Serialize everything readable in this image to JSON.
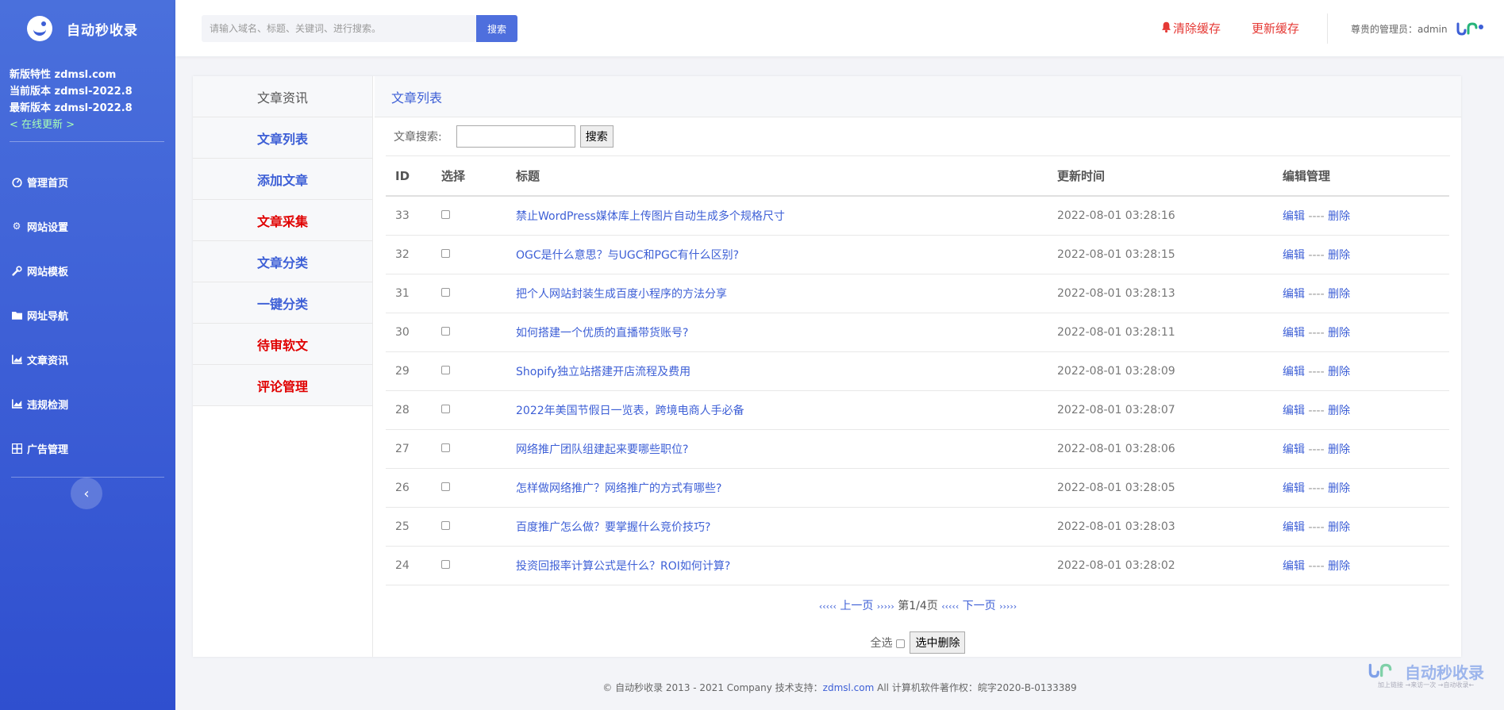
{
  "brand": {
    "name": "自动秒收录"
  },
  "version": {
    "feature": "新版特性 zdmsl.com",
    "current": "当前版本 zdmsl-2022.8",
    "latest": "最新版本 zdmsl-2022.8",
    "update_link": "< 在线更新 >"
  },
  "nav": [
    {
      "label": "管理首页",
      "icon": "dashboard-icon"
    },
    {
      "label": "网站设置",
      "icon": "gear-icon"
    },
    {
      "label": "网站模板",
      "icon": "wrench-icon"
    },
    {
      "label": "网址导航",
      "icon": "folder-icon"
    },
    {
      "label": "文章资讯",
      "icon": "chart-icon"
    },
    {
      "label": "违规检测",
      "icon": "chart-icon"
    },
    {
      "label": "广告管理",
      "icon": "grid-icon"
    }
  ],
  "topbar": {
    "search_placeholder": "请输入域名、标题、关键词、进行搜索。",
    "search_btn": "搜索",
    "clear_cache": "清除缓存",
    "refresh_cache": "更新缓存",
    "admin": "尊贵的管理员：admin"
  },
  "subnav": [
    {
      "label": "文章资讯"
    },
    {
      "label": "文章列表"
    },
    {
      "label": "添加文章"
    },
    {
      "label": "文章采集"
    },
    {
      "label": "文章分类"
    },
    {
      "label": "一键分类"
    },
    {
      "label": "待审软文"
    },
    {
      "label": "评论管理"
    }
  ],
  "main": {
    "title": "文章列表",
    "filter_label": "文章搜索:",
    "filter_btn": "搜索",
    "columns": [
      "ID",
      "选择",
      "标题",
      "更新时间",
      "编辑管理"
    ],
    "rows": [
      {
        "id": "33",
        "title": "禁止WordPress媒体库上传图片自动生成多个规格尺寸",
        "time": "2022-08-01 03:28:16"
      },
      {
        "id": "32",
        "title": "OGC是什么意思？与UGC和PGC有什么区别?",
        "time": "2022-08-01 03:28:15"
      },
      {
        "id": "31",
        "title": "把个人网站封装生成百度小程序的方法分享",
        "time": "2022-08-01 03:28:13"
      },
      {
        "id": "30",
        "title": "如何搭建一个优质的直播带货账号?",
        "time": "2022-08-01 03:28:11"
      },
      {
        "id": "29",
        "title": "Shopify独立站搭建开店流程及费用",
        "time": "2022-08-01 03:28:09"
      },
      {
        "id": "28",
        "title": "2022年美国节假日一览表，跨境电商人手必备",
        "time": "2022-08-01 03:28:07"
      },
      {
        "id": "27",
        "title": "网络推广团队组建起来要哪些职位?",
        "time": "2022-08-01 03:28:06"
      },
      {
        "id": "26",
        "title": "怎样做网络推广？网络推广的方式有哪些?",
        "time": "2022-08-01 03:28:05"
      },
      {
        "id": "25",
        "title": "百度推广怎么做？要掌握什么竞价技巧?",
        "time": "2022-08-01 03:28:03"
      },
      {
        "id": "24",
        "title": "投资回报率计算公式是什么？ROI如何计算?",
        "time": "2022-08-01 03:28:02"
      }
    ],
    "edit_label": "编辑",
    "op_sep": "----",
    "delete_label": "删除",
    "pager": {
      "prev_arrows": "‹‹‹‹‹",
      "prev": "上一页",
      "mid_arrows_1": "›››››",
      "page_info": "第1/4页",
      "mid_arrows_2": "‹‹‹‹‹",
      "next": "下一页",
      "next_arrows": "›››››"
    },
    "select_all": "全选",
    "delete_selected": "选中删除"
  },
  "footer": {
    "prefix": "© 自动秒收录 2013 - 2021 Company 技术支持：",
    "link": "zdmsl.com",
    "suffix": " All 计算机软件著作权：皖字2020-B-0133389"
  },
  "watermark": {
    "text": "自动秒收录",
    "sub": "加上链接 →来访一次 →自动收录←"
  }
}
